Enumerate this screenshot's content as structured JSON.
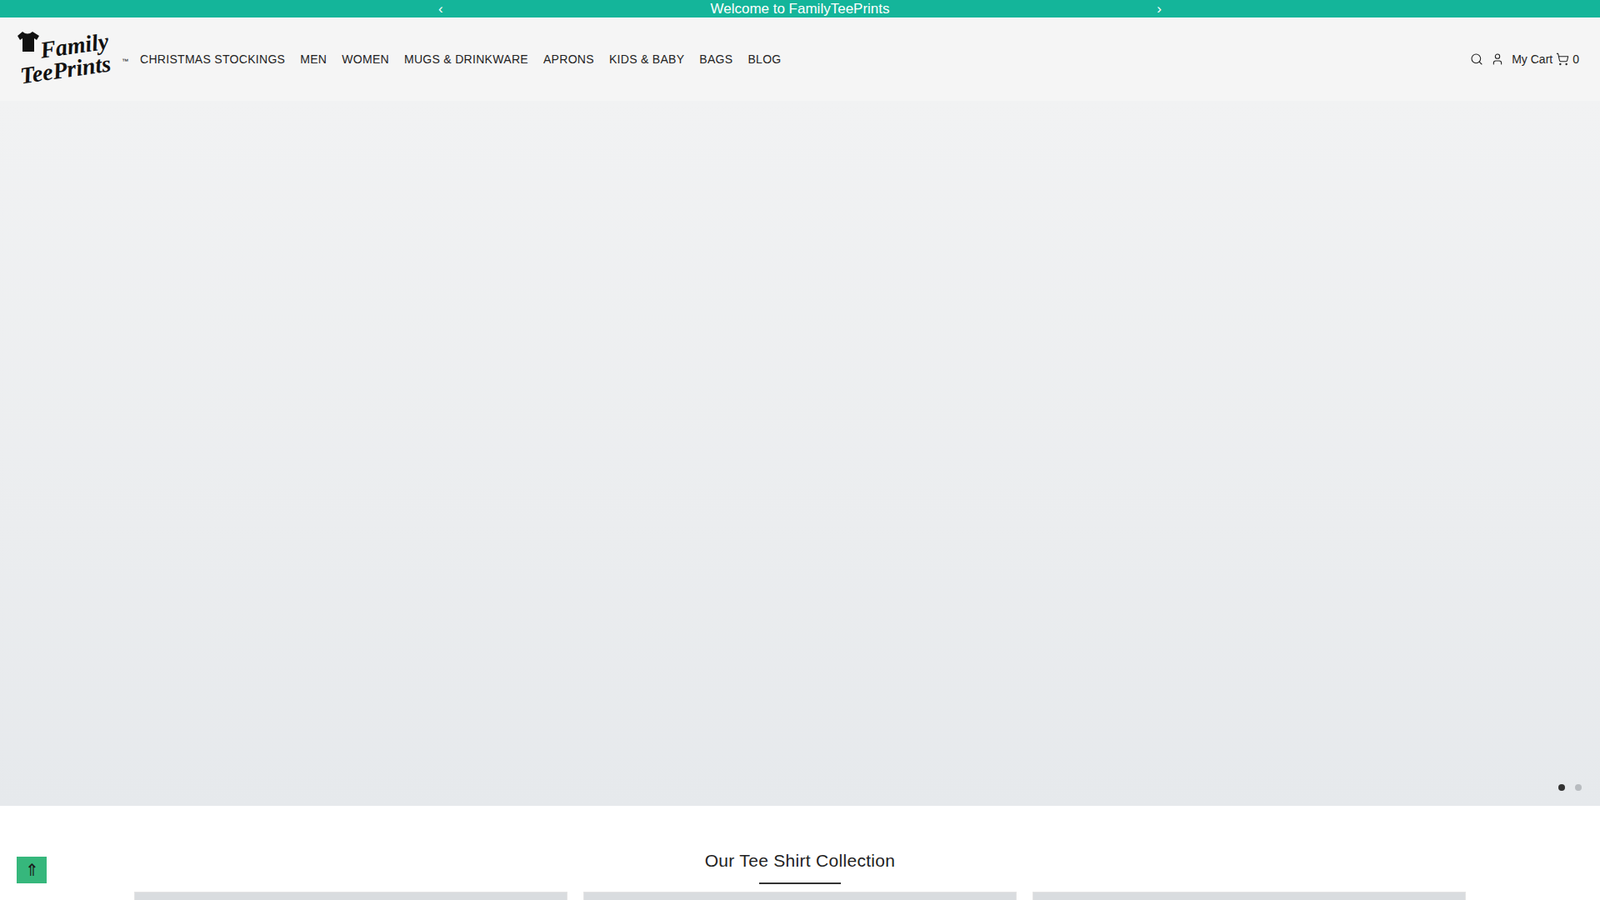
{
  "announcement": {
    "text": "Welcome to FamilyTeePrints",
    "prev": "‹",
    "next": "›"
  },
  "logo": {
    "line1": "Family",
    "line2": "TeePrints",
    "mark": "™"
  },
  "nav": [
    {
      "label": "CHRISTMAS STOCKINGS"
    },
    {
      "label": "MEN"
    },
    {
      "label": "WOMEN"
    },
    {
      "label": "MUGS & DRINKWARE"
    },
    {
      "label": "APRONS"
    },
    {
      "label": "KIDS & BABY"
    },
    {
      "label": "BAGS"
    },
    {
      "label": "BLOG"
    }
  ],
  "header_actions": {
    "cart_label": "My Cart",
    "cart_count": "0"
  },
  "hero": {
    "slides": [
      {
        "selected": true
      },
      {
        "selected": false
      }
    ]
  },
  "collection": {
    "title": "Our Tee Shirt Collection",
    "cards": [
      {
        "kind": "image"
      },
      {
        "kind": "image"
      },
      {
        "kind": "image"
      }
    ]
  },
  "scroll_top": {
    "label": "⇑"
  }
}
